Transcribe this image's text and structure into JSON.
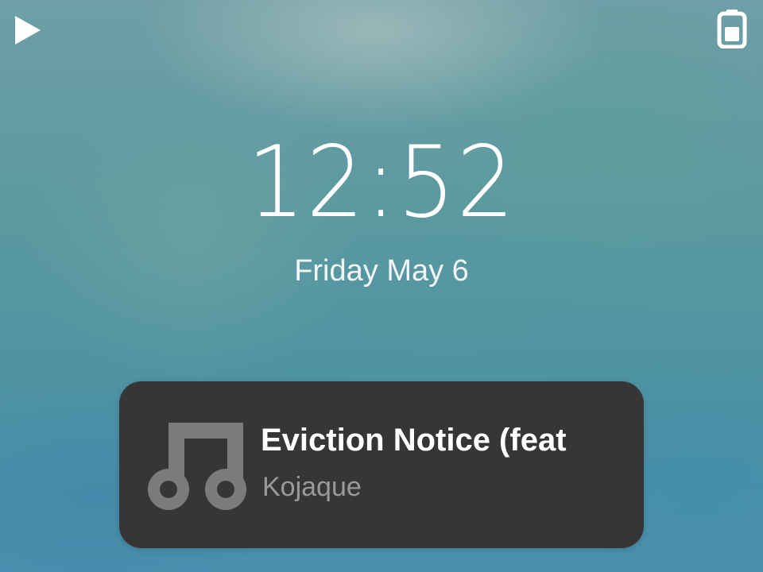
{
  "status_bar": {
    "left_icon": "play-icon",
    "right_icon": "battery-icon",
    "icon_color": "#ffffff"
  },
  "lockscreen": {
    "time": "12:52",
    "date": "Friday May 6"
  },
  "media": {
    "icon": "music-note-icon",
    "title": "Eviction Notice (feat",
    "artist": "Kojaque",
    "card_color": "#353635",
    "icon_color": "#7b7b7b",
    "title_color": "#ffffff",
    "artist_color": "#9a9a9a"
  }
}
